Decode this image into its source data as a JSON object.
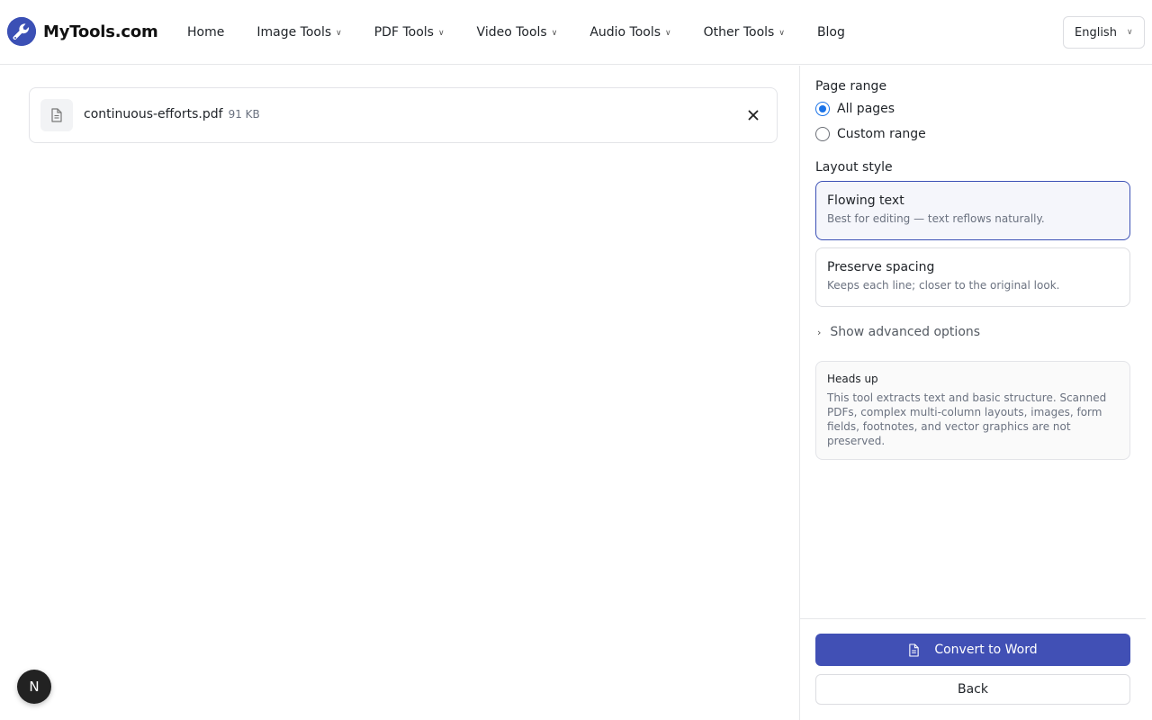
{
  "brand": {
    "name": "MyTools.com",
    "accent": "#3b50b5"
  },
  "nav": {
    "items": [
      {
        "label": "Home",
        "has_menu": false
      },
      {
        "label": "Image Tools",
        "has_menu": true
      },
      {
        "label": "PDF Tools",
        "has_menu": true
      },
      {
        "label": "Video Tools",
        "has_menu": true
      },
      {
        "label": "Audio Tools",
        "has_menu": true
      },
      {
        "label": "Other Tools",
        "has_menu": true
      },
      {
        "label": "Blog",
        "has_menu": false
      }
    ]
  },
  "language": {
    "selected": "English"
  },
  "file": {
    "name": "continuous-efforts.pdf",
    "size": "91 KB",
    "icon": "document-icon"
  },
  "sidebar": {
    "page_range": {
      "label": "Page range",
      "options": [
        {
          "label": "All pages",
          "checked": true
        },
        {
          "label": "Custom range",
          "checked": false
        }
      ]
    },
    "layout_style": {
      "label": "Layout style",
      "options": [
        {
          "title": "Flowing text",
          "desc": "Best for editing — text reflows naturally.",
          "selected": true
        },
        {
          "title": "Preserve spacing",
          "desc": "Keeps each line; closer to the original look.",
          "selected": false
        }
      ]
    },
    "advanced_label": "Show advanced options",
    "note": {
      "title": "Heads up",
      "body": "This tool extracts text and basic structure. Scanned PDFs, complex multi-column layouts, images, form fields, footnotes, and vector graphics are not preserved."
    },
    "convert_label": "Convert to Word",
    "back_label": "Back"
  },
  "badge": {
    "letter": "N"
  },
  "colors": {
    "primary_button": "#4150b5",
    "radio_checked": "#1a73e8"
  }
}
